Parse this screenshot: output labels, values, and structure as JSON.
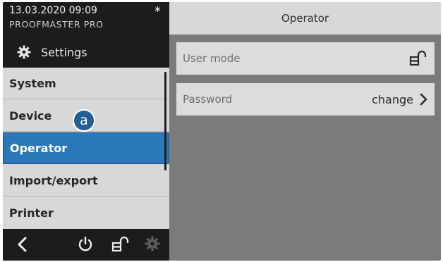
{
  "header": {
    "datetime": "13.03.2020 09:09",
    "bluetooth_symbol": "∗",
    "model": "PROOFMASTER PRO",
    "settings_label": "Settings"
  },
  "menu": {
    "items": [
      {
        "label": "System"
      },
      {
        "label": "Device"
      },
      {
        "label": "Operator"
      },
      {
        "label": "Import/export"
      },
      {
        "label": "Printer"
      }
    ],
    "selected": "Operator",
    "callout_label": "a"
  },
  "footer": {
    "icons": [
      "back-icon",
      "power-icon",
      "lock-open-icon",
      "gear-icon"
    ]
  },
  "panel": {
    "title": "Operator",
    "rows": [
      {
        "label": "User mode",
        "value": "",
        "icon": "lock-open-icon"
      },
      {
        "label": "Password",
        "value": "change",
        "icon": "chevron-right-icon"
      }
    ]
  },
  "colors": {
    "accent": "#2a78b8",
    "dark": "#1c1c1c",
    "menu_bg": "#d8d8d8",
    "content_bg": "#7b7b7b"
  }
}
